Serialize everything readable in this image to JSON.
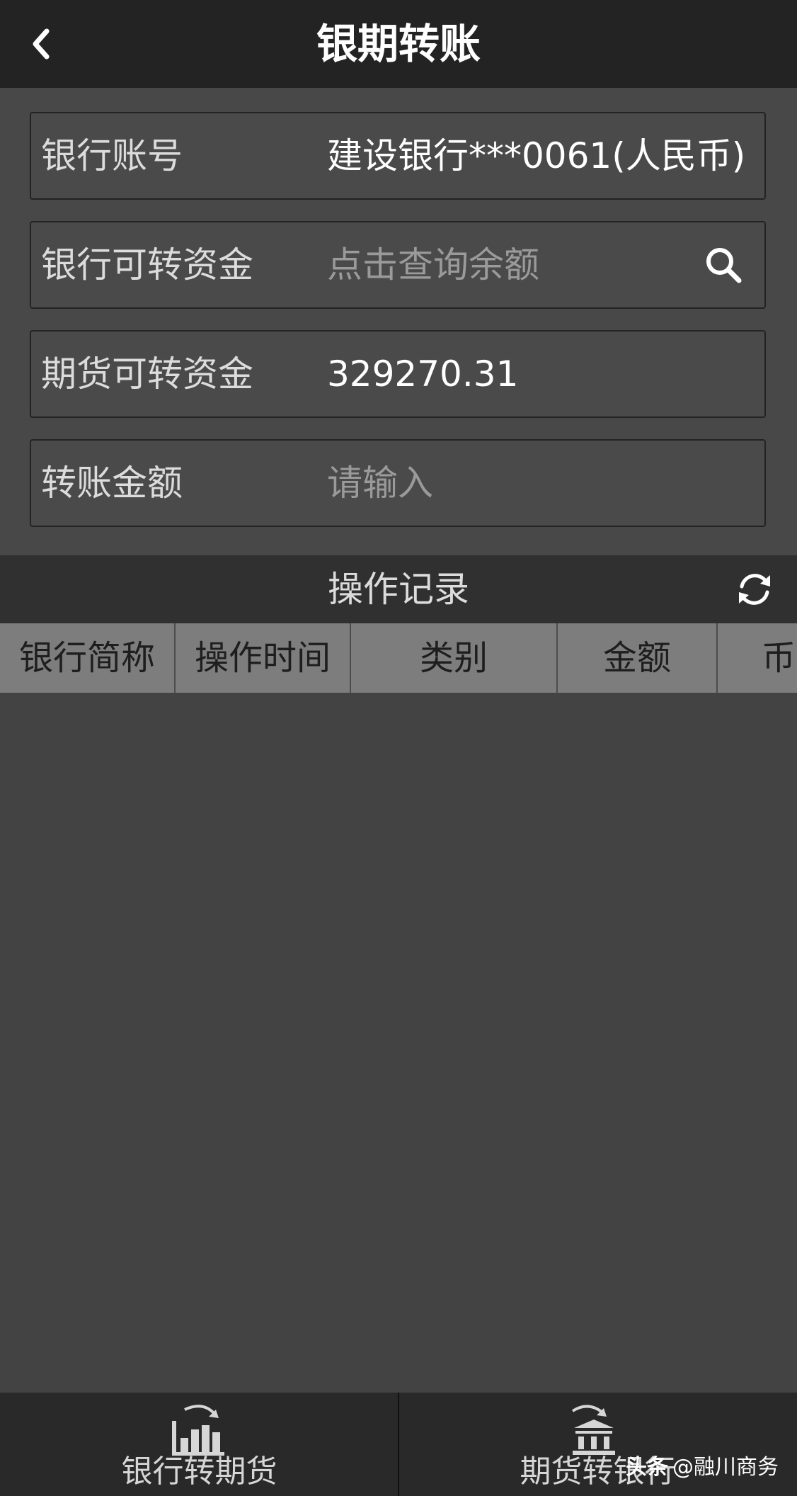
{
  "header": {
    "title": "银期转账",
    "back_icon": "chevron-left-icon"
  },
  "form": {
    "bank_account": {
      "label": "银行账号",
      "value": "建设银行***0061(人民币)"
    },
    "bank_transferable": {
      "label": "银行可转资金",
      "placeholder": "点击查询余额",
      "icon": "search-icon"
    },
    "futures_transferable": {
      "label": "期货可转资金",
      "value": "329270.31"
    },
    "transfer_amount": {
      "label": "转账金额",
      "placeholder": "请输入"
    }
  },
  "records": {
    "title": "操作记录",
    "refresh_icon": "refresh-icon",
    "columns": [
      "银行简称",
      "操作时间",
      "类别",
      "金额",
      "币"
    ],
    "rows": []
  },
  "tabbar": {
    "tabs": [
      {
        "label": "银行转期货",
        "icon": "bank-to-futures-icon"
      },
      {
        "label": "期货转银行",
        "icon": "futures-to-bank-icon"
      }
    ]
  },
  "watermark": {
    "brand": "头条",
    "handle": "@融川商务"
  },
  "colors": {
    "header_bg": "#232323",
    "form_bg": "#484848",
    "table_header_bg": "#7d7d7d",
    "tabbar_bg": "#292929"
  }
}
